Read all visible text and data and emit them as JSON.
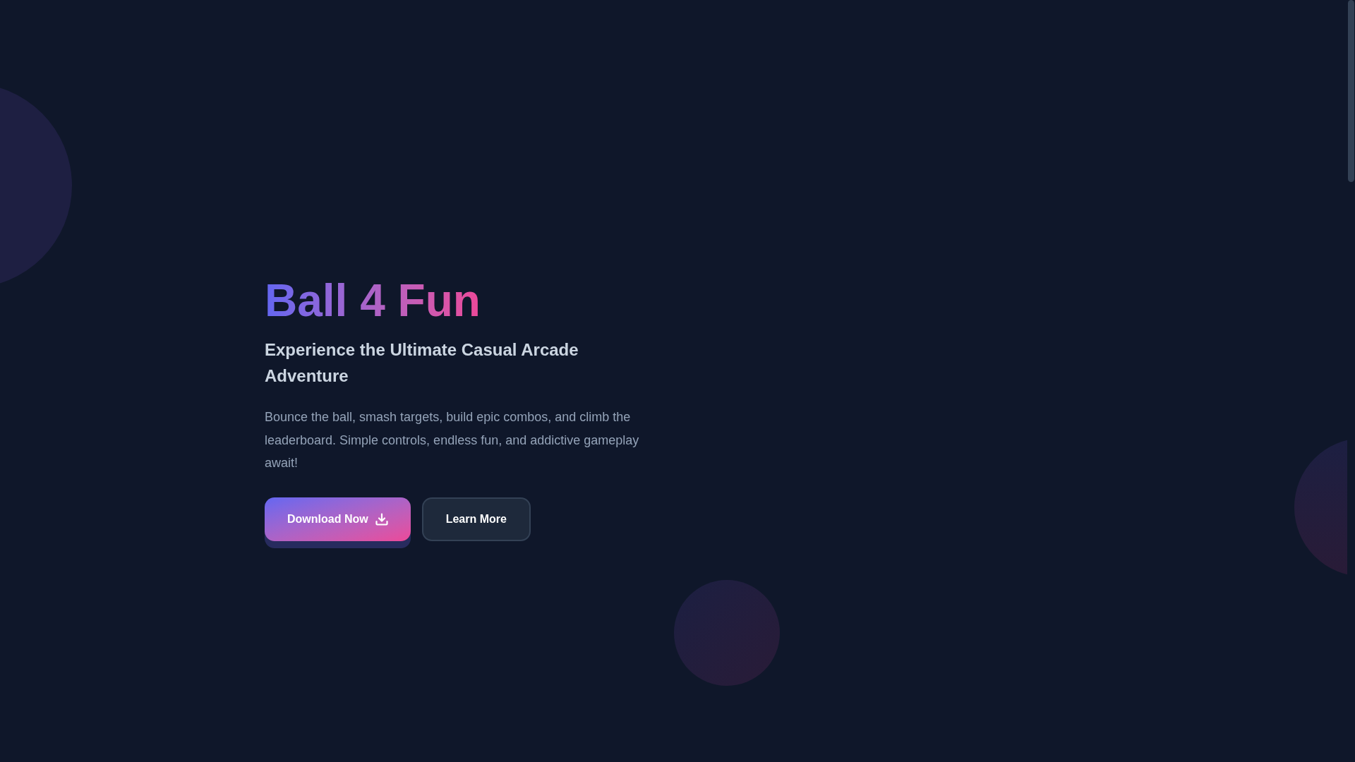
{
  "hero": {
    "title": "Ball 4 Fun",
    "subtitle": "Experience the Ultimate Casual Arcade Adventure",
    "description": "Bounce the ball, smash targets, build epic combos, and climb the leaderboard. Simple controls, endless fun, and addictive gameplay await!",
    "buttons": [
      {
        "kind": "primary",
        "label": "Download Now"
      },
      {
        "kind": "secondary",
        "label": "Learn More"
      }
    ]
  }
}
